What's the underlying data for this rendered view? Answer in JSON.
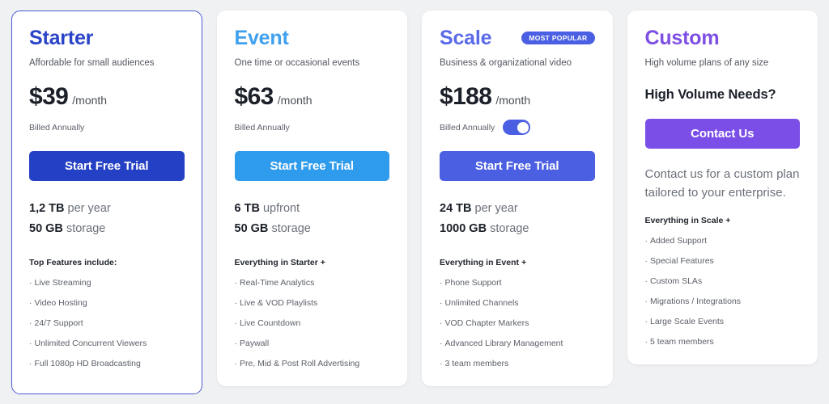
{
  "theme": {
    "page_background": "#f0f1f3",
    "card_background": "#ffffff",
    "selected_border": "#4a5bd0"
  },
  "plans": [
    {
      "id": "starter",
      "name": "Starter",
      "name_color": "#2b44c7",
      "button_color": "#2440c4",
      "tagline": "Affordable for small audiences",
      "price_amount": "$39",
      "price_period": "/month",
      "billing_label": "Billed Annually",
      "has_toggle": false,
      "cta_label": "Start Free Trial",
      "quota": [
        {
          "value": "1,2 TB",
          "unit": "per year"
        },
        {
          "value": "50 GB",
          "unit": "storage"
        }
      ],
      "features_title": "Top Features include:",
      "features": [
        "Live Streaming",
        "Video Hosting",
        "24/7 Support",
        "Unlimited Concurrent Viewers",
        "Full 1080p HD Broadcasting"
      ],
      "selected": true,
      "badge": null
    },
    {
      "id": "event",
      "name": "Event",
      "name_color": "#3fa0ee",
      "button_color": "#2f9bec",
      "tagline": "One time or occasional events",
      "price_amount": "$63",
      "price_period": "/month",
      "billing_label": "Billed Annually",
      "has_toggle": false,
      "cta_label": "Start Free Trial",
      "quota": [
        {
          "value": "6 TB",
          "unit": "upfront"
        },
        {
          "value": "50 GB",
          "unit": "storage"
        }
      ],
      "features_title": "Everything in Starter +",
      "features": [
        "Real-Time Analytics",
        "Live & VOD Playlists",
        "Live Countdown",
        "Paywall",
        "Pre, Mid & Post Roll Advertising"
      ],
      "selected": false,
      "badge": null
    },
    {
      "id": "scale",
      "name": "Scale",
      "name_color": "#5b6ae8",
      "button_color": "#4b5fe2",
      "tagline": "Business & organizational video",
      "price_amount": "$188",
      "price_period": "/month",
      "billing_label": "Billed Annually",
      "has_toggle": true,
      "toggle_state": "on",
      "cta_label": "Start Free Trial",
      "quota": [
        {
          "value": "24 TB",
          "unit": "per year"
        },
        {
          "value": "1000 GB",
          "unit": "storage"
        }
      ],
      "features_title": "Everything in Event +",
      "features": [
        "Phone Support",
        "Unlimited Channels",
        "VOD Chapter Markers",
        "Advanced Library Management",
        "3 team members"
      ],
      "selected": false,
      "badge": "MOST POPULAR"
    },
    {
      "id": "custom",
      "name": "Custom",
      "name_color": "#7e4fe4",
      "button_color": "#7b4ee8",
      "tagline": "High volume plans of any size",
      "headline": "High Volume Needs?",
      "cta_label": "Contact Us",
      "description": "Contact us for a custom plan tailored to your enterprise.",
      "features_title": "Everything in Scale +",
      "features": [
        "Added Support",
        "Special Features",
        "Custom SLAs",
        "Migrations / Integrations",
        "Large Scale Events",
        "5 team members"
      ],
      "selected": false,
      "badge": null
    }
  ],
  "bullet_glyph": "·"
}
